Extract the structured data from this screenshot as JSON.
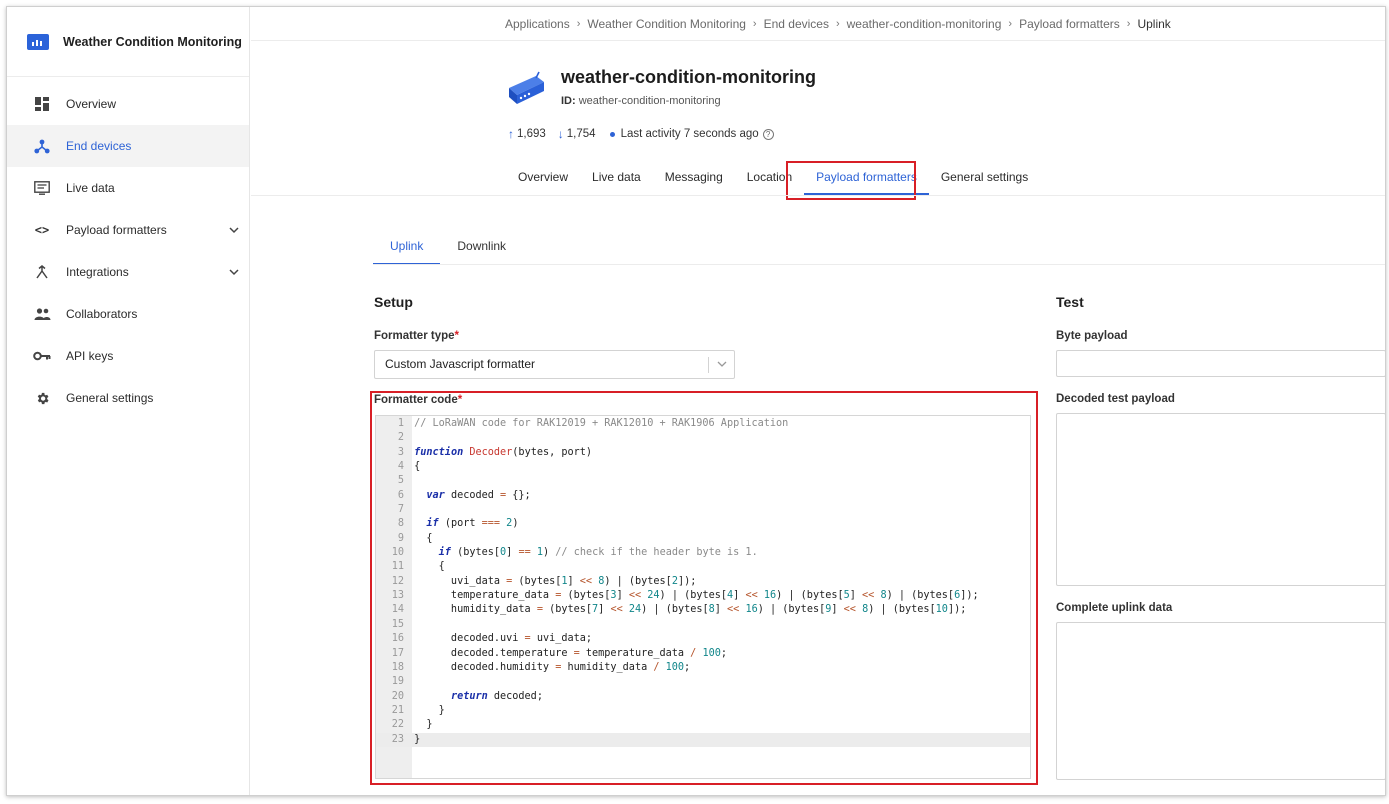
{
  "app": {
    "brand_title": "Weather Condition Monitoring"
  },
  "sidebar": {
    "items": [
      {
        "label": "Overview",
        "icon": "dashboard-icon"
      },
      {
        "label": "End devices",
        "icon": "devices-icon",
        "active": true
      },
      {
        "label": "Live data",
        "icon": "live-data-icon"
      },
      {
        "label": "Payload formatters",
        "icon": "code-icon",
        "expandable": true
      },
      {
        "label": "Integrations",
        "icon": "integrations-icon",
        "expandable": true
      },
      {
        "label": "Collaborators",
        "icon": "collaborators-icon"
      },
      {
        "label": "API keys",
        "icon": "key-icon"
      },
      {
        "label": "General settings",
        "icon": "gear-icon"
      }
    ]
  },
  "breadcrumb": [
    "Applications",
    "Weather Condition Monitoring",
    "End devices",
    "weather-condition-monitoring",
    "Payload formatters",
    "Uplink"
  ],
  "device": {
    "title": "weather-condition-monitoring",
    "id_label": "ID:",
    "id_value": "weather-condition-monitoring",
    "uplink_count": "1,693",
    "downlink_count": "1,754",
    "last_activity": "Last activity 7 seconds ago"
  },
  "tabs": [
    "Overview",
    "Live data",
    "Messaging",
    "Location",
    "Payload formatters",
    "General settings"
  ],
  "active_tab": "Payload formatters",
  "subtabs": [
    "Uplink",
    "Downlink"
  ],
  "setup": {
    "heading": "Setup",
    "formatter_type_label": "Formatter type",
    "formatter_type_value": "Custom Javascript formatter",
    "formatter_code_label": "Formatter code",
    "required_mark": "*"
  },
  "test": {
    "heading": "Test",
    "byte_payload_label": "Byte payload",
    "decoded_label": "Decoded test payload",
    "complete_label": "Complete uplink data"
  },
  "code_lines": [
    "// LoRaWAN code for RAK12019 + RAK12010 + RAK1906 Application",
    "",
    "function Decoder(bytes, port)",
    "{",
    "",
    "  var decoded = {};",
    "",
    "  if (port === 2)",
    "  {",
    "    if (bytes[0] == 1) // check if the header byte is 1.",
    "    {",
    "      uvi_data = (bytes[1] << 8) | (bytes[2]);",
    "      temperature_data = (bytes[3] << 24) | (bytes[4] << 16) | (bytes[5] << 8) | (bytes[6]);",
    "      humidity_data = (bytes[7] << 24) | (bytes[8] << 16) | (bytes[9] << 8) | (bytes[10]);",
    "",
    "      decoded.uvi = uvi_data;",
    "      decoded.temperature = temperature_data / 100;",
    "      decoded.humidity = humidity_data / 100;",
    "",
    "      return decoded;",
    "    }",
    "  }",
    "}"
  ],
  "colors": {
    "accent": "#2e63d6",
    "highlight": "#d81f26",
    "keyword": "#1a2fa8",
    "function_name": "#c7372f",
    "number": "#11868a",
    "comment": "#8a8a8a",
    "operator": "#b5542b"
  }
}
